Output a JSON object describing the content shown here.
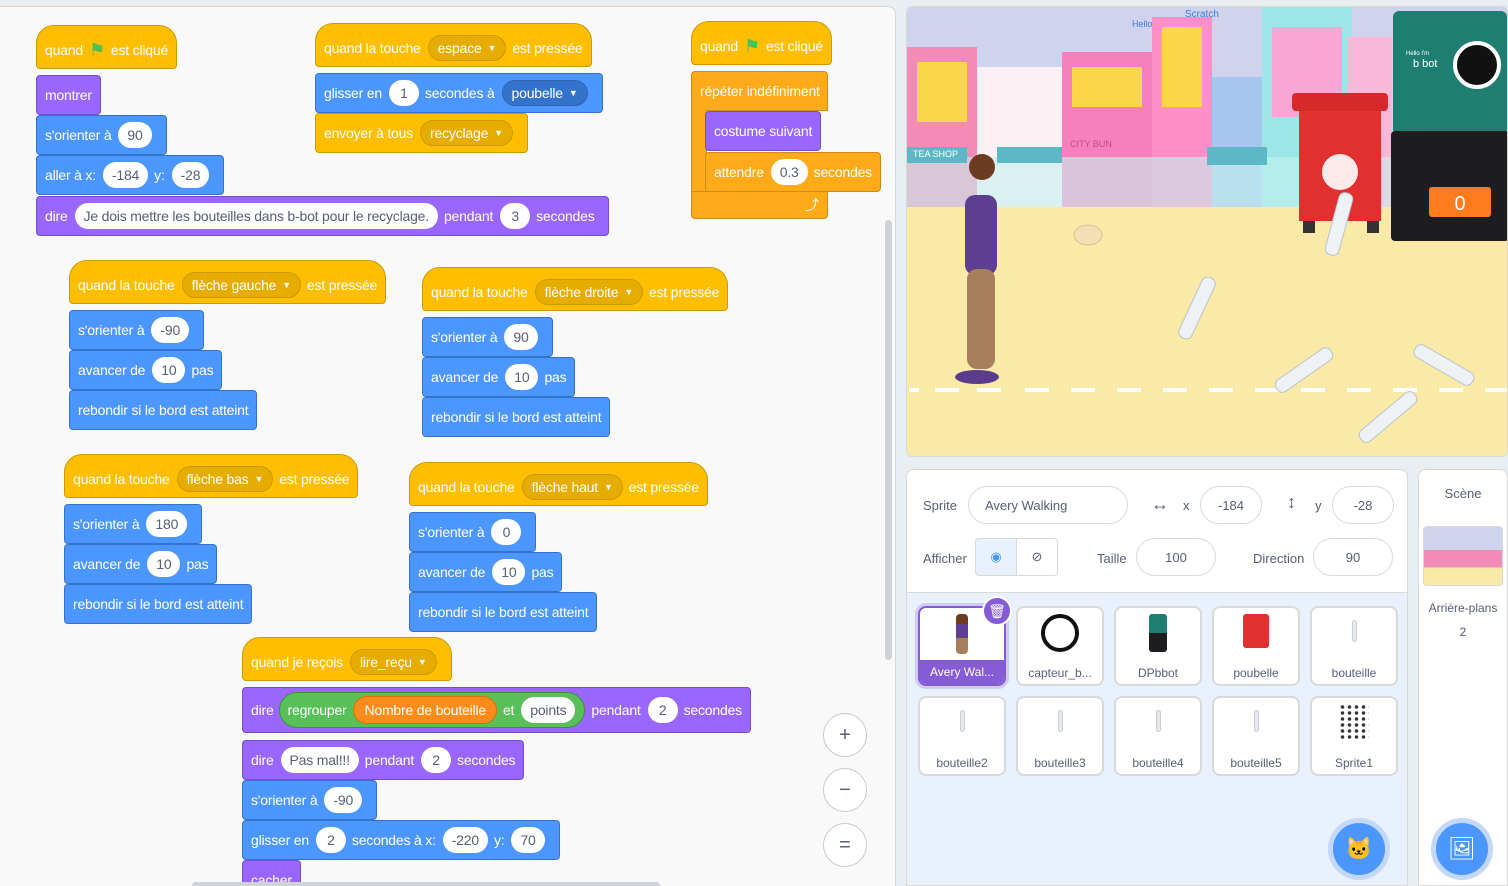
{
  "blocks": {
    "s1": {
      "hat": {
        "when": "quand",
        "clicked": "est cliqué"
      },
      "show": "montrer",
      "point": {
        "label": "s'orienter à",
        "value": "90"
      },
      "goto": {
        "label": "aller à x:",
        "x": "-184",
        "ylabel": "y:",
        "y": "-28"
      },
      "say": {
        "label": "dire",
        "text": "Je dois mettre les bouteilles dans b-bot pour le recyclage.",
        "for": "pendant",
        "secs": "3",
        "unit": "secondes"
      }
    },
    "s2": {
      "hat": {
        "pre": "quand la touche",
        "key": "espace",
        "post": "est pressée"
      },
      "glide": {
        "label": "glisser en",
        "secs": "1",
        "mid": "secondes à",
        "target": "poubelle"
      },
      "broadcast": {
        "label": "envoyer à tous",
        "msg": "recyclage"
      }
    },
    "s3": {
      "hat": {
        "when": "quand",
        "clicked": "est cliqué"
      },
      "forever": "répéter indéfiniment",
      "next": "costume suivant",
      "wait": {
        "label": "attendre",
        "secs": "0.3",
        "unit": "secondes"
      },
      "loop_arrow": "⤴"
    },
    "s4": {
      "hat": {
        "pre": "quand la touche",
        "key": "flèche gauche",
        "post": "est pressée"
      },
      "point": {
        "label": "s'orienter à",
        "value": "-90"
      },
      "move": {
        "label": "avancer de",
        "steps": "10",
        "unit": "pas"
      },
      "bounce": "rebondir si le bord est atteint"
    },
    "s5": {
      "hat": {
        "pre": "quand la touche",
        "key": "flèche droite",
        "post": "est pressée"
      },
      "point": {
        "label": "s'orienter à",
        "value": "90"
      },
      "move": {
        "label": "avancer de",
        "steps": "10",
        "unit": "pas"
      },
      "bounce": "rebondir si le bord est atteint"
    },
    "s6": {
      "hat": {
        "pre": "quand la touche",
        "key": "flèche bas",
        "post": "est pressée"
      },
      "point": {
        "label": "s'orienter à",
        "value": "180"
      },
      "move": {
        "label": "avancer de",
        "steps": "10",
        "unit": "pas"
      },
      "bounce": "rebondir si le bord est atteint"
    },
    "s7": {
      "hat": {
        "pre": "quand la touche",
        "key": "flèche haut",
        "post": "est pressée"
      },
      "point": {
        "label": "s'orienter à",
        "value": "0"
      },
      "move": {
        "label": "avancer de",
        "steps": "10",
        "unit": "pas"
      },
      "bounce": "rebondir si le bord est atteint"
    },
    "s8": {
      "hat": {
        "pre": "quand je reçois",
        "msg": "lire_reçu"
      },
      "say1": {
        "label": "dire",
        "join": "regrouper",
        "var": "Nombre de bouteille",
        "and": "et",
        "text": "points",
        "for": "pendant",
        "secs": "2",
        "unit": "secondes"
      },
      "say2": {
        "label": "dire",
        "text": "Pas mal!!!",
        "for": "pendant",
        "secs": "2",
        "unit": "secondes"
      },
      "point": {
        "label": "s'orienter à",
        "value": "-90"
      },
      "glide": {
        "label": "glisser en",
        "secs": "2",
        "mid": "secondes à x:",
        "x": "-220",
        "ylabel": "y:",
        "y": "70"
      },
      "hide": "cacher"
    }
  },
  "zoom": {
    "in": "+",
    "out": "−",
    "reset": "="
  },
  "stage": {
    "shop_sign": "TEA SHOP",
    "city_sign": "CITY BUN",
    "scratch_sign": "Scratch",
    "hello_sign": "Hello",
    "bbot_text": "b bot",
    "bbot_hello": "Hello I'm",
    "counter": "0"
  },
  "sprite_info": {
    "sprite_label": "Sprite",
    "sprite_name": "Avery Walking",
    "x_label": "x",
    "x": "-184",
    "y_label": "y",
    "y": "-28",
    "show_label": "Afficher",
    "size_label": "Taille",
    "size": "100",
    "direction_label": "Direction",
    "direction": "90"
  },
  "sprites": [
    {
      "name": "Avery Wal...",
      "icon": "avery-icon"
    },
    {
      "name": "capteur_b...",
      "icon": "ring-icon"
    },
    {
      "name": "DPbbot",
      "icon": "bbot-icon"
    },
    {
      "name": "poubelle",
      "icon": "bin-icon"
    },
    {
      "name": "bouteille",
      "icon": "bottle-icon"
    },
    {
      "name": "bouteille2",
      "icon": "bottle-icon"
    },
    {
      "name": "bouteille3",
      "icon": "bottle-icon"
    },
    {
      "name": "bouteille4",
      "icon": "bottle-icon"
    },
    {
      "name": "bouteille5",
      "icon": "bottle-icon"
    },
    {
      "name": "Sprite1",
      "icon": "dots-icon"
    }
  ],
  "scene": {
    "title": "Scène",
    "backdrops_label": "Arrière-plans",
    "backdrops_count": "2"
  },
  "colors": {
    "events": "#ffbf00",
    "motion": "#4c97ff",
    "looks": "#9966ff",
    "control": "#ffab19",
    "operators": "#59c059",
    "selected": "#855cd6"
  }
}
